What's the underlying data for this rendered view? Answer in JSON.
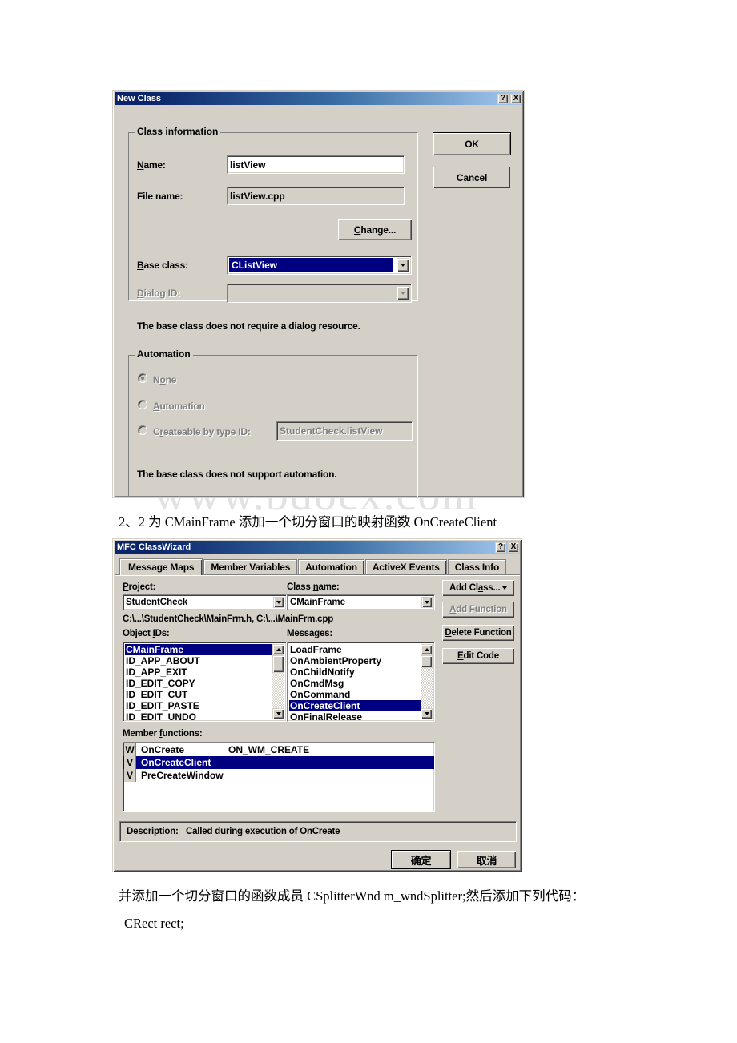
{
  "watermark": "www.bdocx.com",
  "new_class_dialog": {
    "title": "New Class",
    "help_btn": "?",
    "close_btn": "X",
    "ok_label": "OK",
    "cancel_label": "Cancel",
    "class_information": {
      "group_title": "Class information",
      "name_label": "Name:",
      "name_value": "listView",
      "file_name_label": "File name:",
      "file_name_value": "listView.cpp",
      "change_label": "Change...",
      "base_class_label": "Base class:",
      "base_class_value": "CListView",
      "dialog_id_label": "Dialog ID:",
      "dialog_id_value": "",
      "note": "The base class does not require a dialog resource."
    },
    "automation": {
      "group_title": "Automation",
      "options": [
        {
          "label": "None",
          "selected": true
        },
        {
          "label": "Automation",
          "selected": false
        },
        {
          "label": "Createable by type ID:",
          "selected": false
        }
      ],
      "type_id_value": "StudentCheck.listView",
      "note": "The base class does not support automation."
    }
  },
  "body_text": {
    "line1": "2、2 为 CMainFrame 添加一个切分窗口的映射函数 OnCreateClient",
    "line2": "并添加一个切分窗口的函数成员 CSplitterWnd m_wndSplitter;然后添加下列代码：",
    "line3": "CRect rect;"
  },
  "class_wizard": {
    "title": "MFC ClassWizard",
    "help_btn": "?",
    "close_btn": "X",
    "tabs": [
      {
        "label": "Message Maps",
        "active": true
      },
      {
        "label": "Member Variables",
        "active": false
      },
      {
        "label": "Automation",
        "active": false
      },
      {
        "label": "ActiveX Events",
        "active": false
      },
      {
        "label": "Class Info",
        "active": false
      }
    ],
    "project_label": "Project:",
    "project_value": "StudentCheck",
    "class_name_label": "Class name:",
    "class_name_value": "CMainFrame",
    "file_path": "C:\\...\\StudentCheck\\MainFrm.h, C:\\...\\MainFrm.cpp",
    "object_ids_label": "Object IDs:",
    "object_ids": [
      {
        "label": "CMainFrame",
        "selected": true
      },
      {
        "label": "ID_APP_ABOUT",
        "selected": false
      },
      {
        "label": "ID_APP_EXIT",
        "selected": false
      },
      {
        "label": "ID_EDIT_COPY",
        "selected": false
      },
      {
        "label": "ID_EDIT_CUT",
        "selected": false
      },
      {
        "label": "ID_EDIT_PASTE",
        "selected": false
      },
      {
        "label": "ID_EDIT_UNDO",
        "selected": false
      }
    ],
    "messages_label": "Messages:",
    "messages": [
      {
        "label": "LoadFrame",
        "selected": false
      },
      {
        "label": "OnAmbientProperty",
        "selected": false
      },
      {
        "label": "OnChildNotify",
        "selected": false
      },
      {
        "label": "OnCmdMsg",
        "selected": false
      },
      {
        "label": "OnCommand",
        "selected": false
      },
      {
        "label": "OnCreateClient",
        "selected": true
      },
      {
        "label": "OnFinalRelease",
        "selected": false
      }
    ],
    "side_buttons": [
      {
        "label": "Add Class...",
        "disabled": false,
        "has_arrow": true
      },
      {
        "label": "Add Function",
        "disabled": true,
        "has_arrow": false
      },
      {
        "label": "Delete Function",
        "disabled": false,
        "has_arrow": false
      },
      {
        "label": "Edit Code",
        "disabled": false,
        "has_arrow": false
      }
    ],
    "member_functions_label": "Member functions:",
    "member_functions": [
      {
        "icon": "W",
        "name": "OnCreate",
        "message": "ON_WM_CREATE",
        "selected": false
      },
      {
        "icon": "V",
        "name": "OnCreateClient",
        "message": "",
        "selected": true
      },
      {
        "icon": "V",
        "name": "PreCreateWindow",
        "message": "",
        "selected": false
      }
    ],
    "description_label": "Description:",
    "description_value": "Called during execution of OnCreate",
    "ok_label": "确定",
    "cancel_label": "取消"
  }
}
